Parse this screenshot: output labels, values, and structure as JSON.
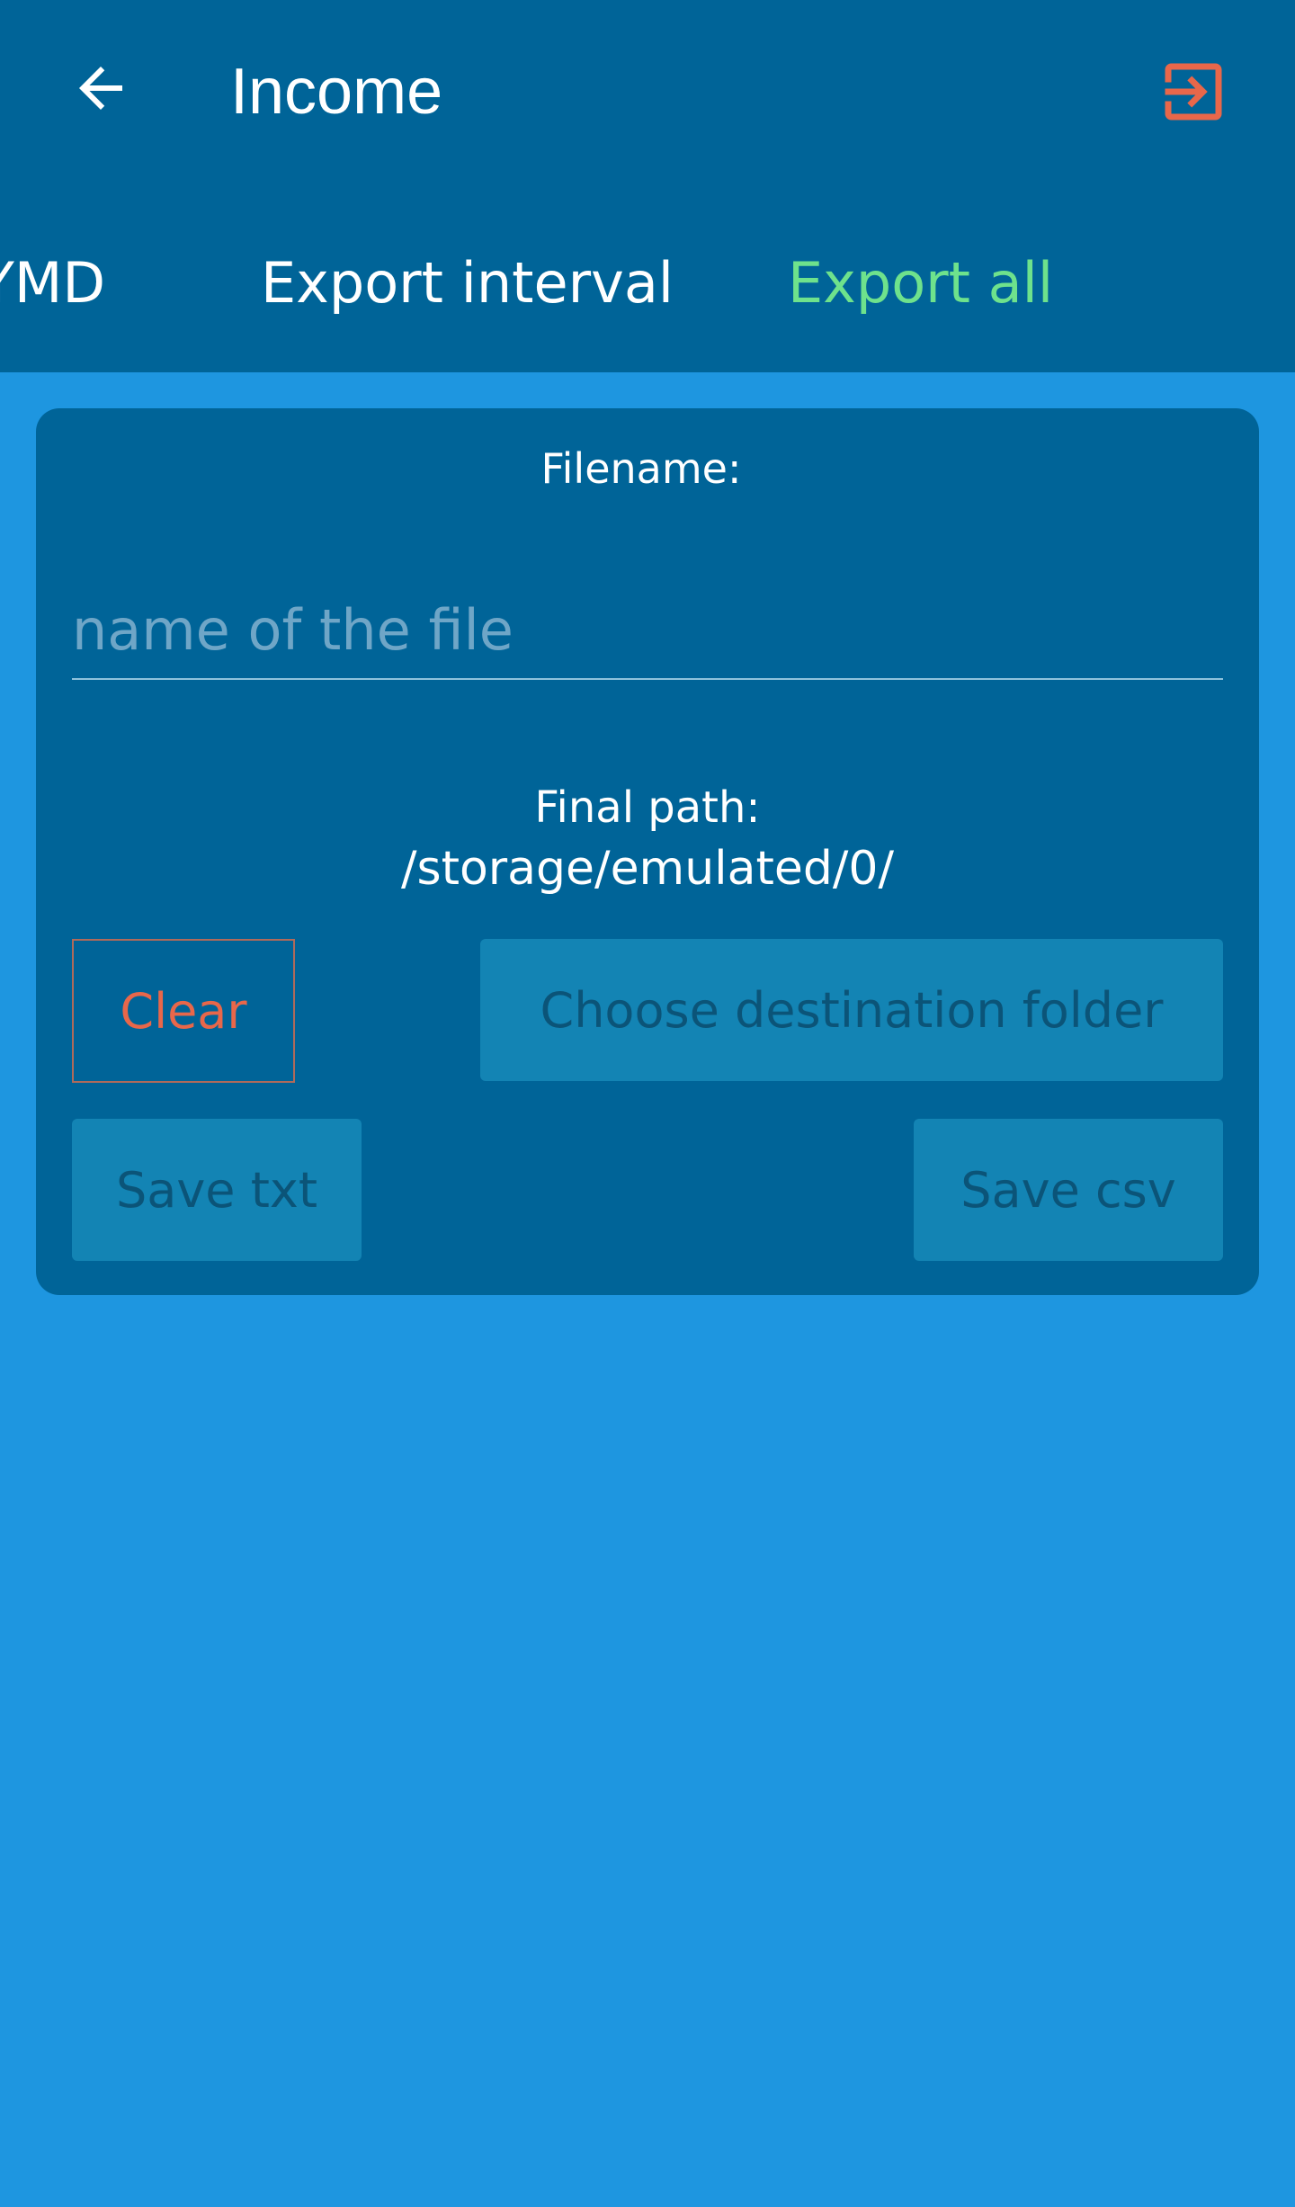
{
  "header": {
    "title": "Income",
    "back_icon": "arrow-left-icon",
    "exit_icon": "exit-to-app-icon",
    "exit_color": "#e8674a"
  },
  "tabs": [
    {
      "label": "YMD",
      "selected": false
    },
    {
      "label": "Export interval",
      "selected": false
    },
    {
      "label": "Export all",
      "selected": true
    }
  ],
  "card": {
    "filename_label": "Filename:",
    "filename_value": "",
    "filename_placeholder": "name of the file",
    "path_label": "Final path:",
    "path_value": "/storage/emulated/0/",
    "clear_label": "Clear",
    "choose_folder_label": "Choose destination folder",
    "save_txt_label": "Save txt",
    "save_csv_label": "Save csv"
  },
  "colors": {
    "background": "#1e96e0",
    "toolbar": "#006498",
    "selected_tab": "#6ee28c",
    "accent": "#e8674a",
    "disabled_button": "#1384b4"
  }
}
